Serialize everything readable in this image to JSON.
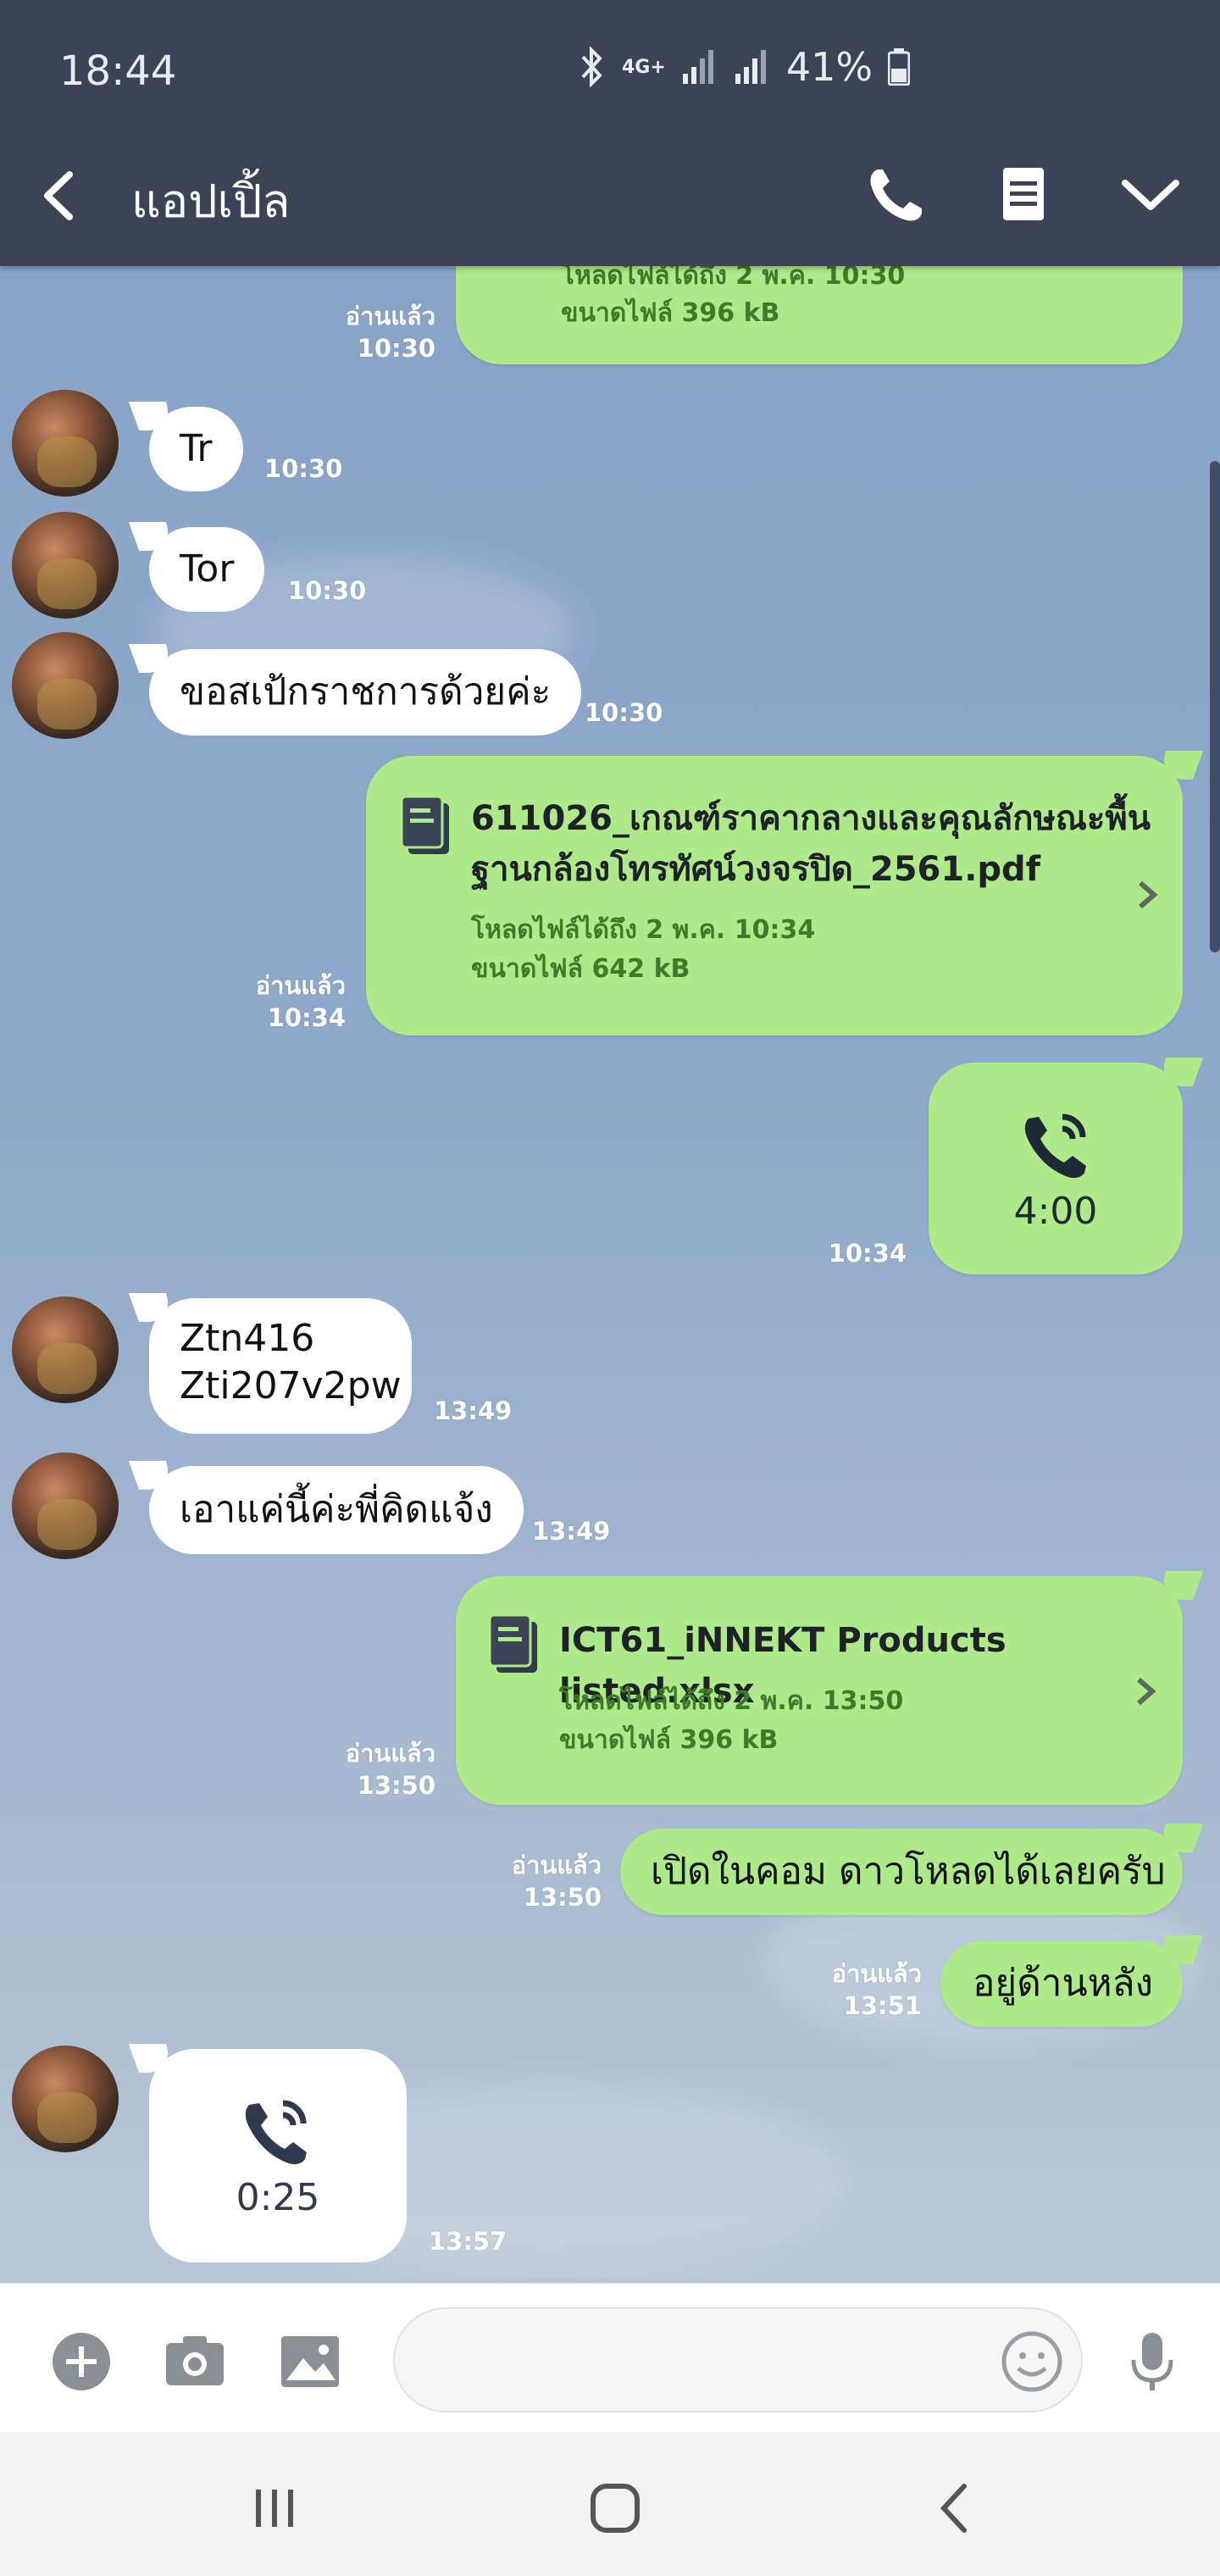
{
  "status_bar": {
    "time": "18:44",
    "network": "4G+",
    "battery": "41%"
  },
  "header": {
    "title": "แอปเปิ้ล",
    "back_icon": "back-arrow-icon",
    "call_icon": "phone-icon",
    "menu_icon": "notes-icon",
    "dropdown_icon": "chevron-down-icon"
  },
  "messages": {
    "m0": {
      "meta": "ขนาดไฟล์ 396 kB",
      "meta_top": "โหลดไฟล์ได้ถึง 2 พ.ค. 10:30",
      "read": "อ่านแล้ว",
      "time": "10:30"
    },
    "m1": {
      "text": "Tr",
      "time": "10:30"
    },
    "m2": {
      "text": "Tor",
      "time": "10:30"
    },
    "m3": {
      "text": "ขอสเป้กราชการด้วยค่ะ",
      "time": "10:30"
    },
    "m4": {
      "title_line1": "611026_เกณฑ์ราคากลางและคุณลักษณะพื้น",
      "title_line2": "ฐานกล้องโทรทัศน์วงจรปิด_2561.pdf",
      "expiry": "โหลดไฟล์ได้ถึง 2 พ.ค. 10:34",
      "size": "ขนาดไฟล์ 642 kB",
      "read": "อ่านแล้ว",
      "time": "10:34"
    },
    "m5": {
      "duration": "4:00",
      "time": "10:34"
    },
    "m6": {
      "line1": "Ztn416",
      "line2": "Zti207v2pw",
      "time": "13:49"
    },
    "m7": {
      "text": "เอาแค่นี้ค่ะพี่คิดแจ้ง",
      "time": "13:49"
    },
    "m8": {
      "title": "ICT61_iNNEKT Products listed.xlsx",
      "expiry": "โหลดไฟล์ได้ถึง 2 พ.ค. 13:50",
      "size": "ขนาดไฟล์ 396 kB",
      "read": "อ่านแล้ว",
      "time": "13:50"
    },
    "m9": {
      "text": "เปิดในคอม ดาวโหลดได้เลยครับ",
      "read": "อ่านแล้ว",
      "time": "13:50"
    },
    "m10": {
      "text": "อยู่ด้านหลัง",
      "read": "อ่านแล้ว",
      "time": "13:51"
    },
    "m11": {
      "duration": "0:25",
      "time": "13:57"
    }
  },
  "input_bar": {
    "placeholder": "",
    "icons": [
      "plus-icon",
      "camera-icon",
      "image-icon",
      "emoji-icon",
      "microphone-icon"
    ]
  },
  "colors": {
    "header_bg": "#3b4354",
    "outgoing_bubble": "#aeea8a",
    "incoming_bubble": "#ffffff",
    "chat_bg": "#8aa6c8"
  }
}
